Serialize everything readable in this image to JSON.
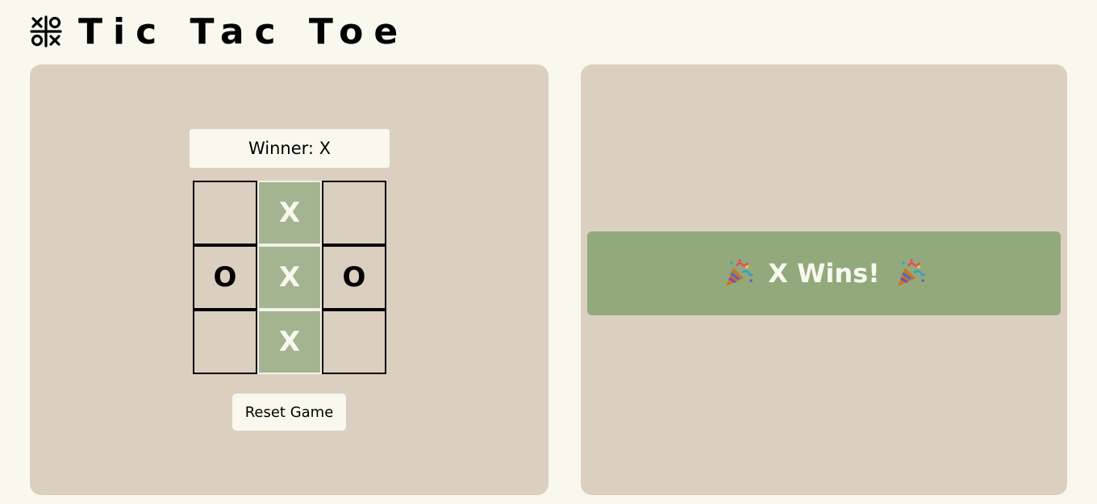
{
  "header": {
    "title": "Tic Tac Toe",
    "logo_icon": "tic-tac-toe-icon"
  },
  "game": {
    "status": "Winner: X",
    "board": [
      "",
      "X",
      "",
      "O",
      "X",
      "O",
      "",
      "X",
      ""
    ],
    "winning_cells": [
      1,
      4,
      7
    ],
    "reset_label": "Reset Game"
  },
  "result": {
    "message": "X Wins!",
    "icon": "party-popper-icon"
  },
  "colors": {
    "page_background": "#f9f8ee",
    "panel_background": "#dbcfc0",
    "winning_cell": "#a4b490",
    "banner_background": "#91a97b"
  }
}
